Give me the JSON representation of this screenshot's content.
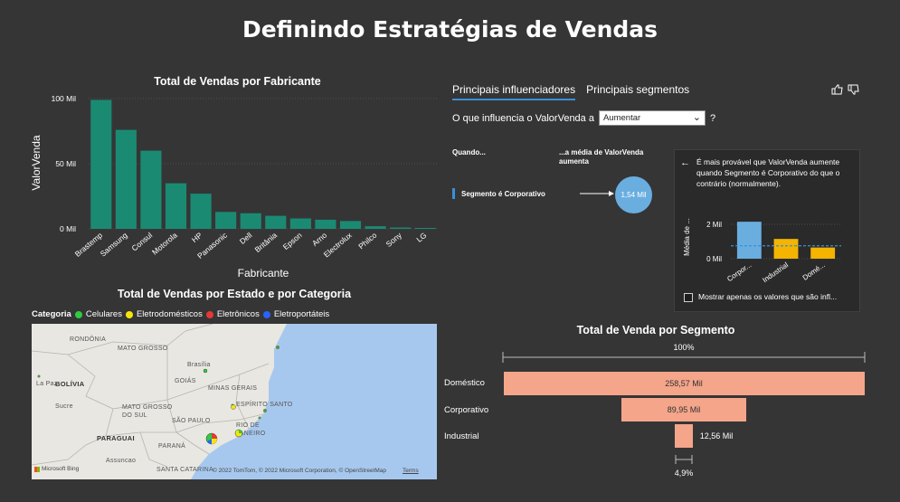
{
  "page": {
    "title": "Definindo Estratégias de Vendas"
  },
  "bar_chart": {
    "title": "Total de Vendas por Fabricante",
    "xlabel": "Fabricante",
    "ylabel": "ValorVenda",
    "y_ticks": [
      "100 Mil",
      "50 Mil",
      "0 Mil"
    ]
  },
  "chart_data": {
    "type": "bar",
    "title": "Total de Vendas por Fabricante",
    "xlabel": "Fabricante",
    "ylabel": "ValorVenda",
    "categories": [
      "Brastemp",
      "Samsung",
      "Consul",
      "Motorola",
      "HP",
      "Panasonic",
      "Dell",
      "Britânia",
      "Epson",
      "Arno",
      "Electrolux",
      "Philco",
      "Sony",
      "LG"
    ],
    "values": [
      99,
      76,
      60,
      35,
      27,
      13,
      12,
      10,
      8,
      7,
      6,
      2,
      1,
      0.7
    ],
    "unit": "Mil",
    "ylim": [
      0,
      100
    ],
    "color": "#1a8a73"
  },
  "influencers": {
    "tabs": [
      "Principais influenciadores",
      "Principais segmentos"
    ],
    "question_prefix": "O que influencia o ValorVenda a",
    "select_value": "Aumentar",
    "question_mark": "?",
    "col_when": "Quando...",
    "col_avg": "...a média de ValorVenda aumenta",
    "row_label": "Segmento é Corporativo",
    "row_value": "1,54 Mil",
    "detail_text": "É mais provável que ValorVenda aumente quando Segmento é Corporativo do que o contrário (normalmente).",
    "mini_ylabel": "Média de ...",
    "mini_ticks": [
      "2 Mil",
      "0 Mil"
    ],
    "mini_categories": [
      "Corpor...",
      "Industrial",
      "Domé..."
    ],
    "mini_values": [
      2.15,
      1.15,
      0.65
    ],
    "mini_avg": 0.75,
    "mini_colors": [
      "#6aaee0",
      "#f4b400",
      "#f4b400"
    ],
    "checkbox_label": "Mostrar apenas os valores que são infl..."
  },
  "map": {
    "title": "Total de Vendas por Estado e por Categoria",
    "legend_title": "Categoria",
    "legend": [
      {
        "label": "Celulares",
        "color": "#2ecc40"
      },
      {
        "label": "Eletrodomésticos",
        "color": "#f5e60a"
      },
      {
        "label": "Eletrônicos",
        "color": "#e53935"
      },
      {
        "label": "Eletroportáteis",
        "color": "#2962ff"
      }
    ],
    "labels": [
      "RONDÔNIA",
      "MATO GROSSO",
      "BOLÍVIA",
      "La Paz",
      "Sucre",
      "Brasília",
      "GOIÁS",
      "MINAS GERAIS",
      "MATO GROSSO DO SUL",
      "ESPÍRITO SANTO",
      "SÃO PAULO",
      "RIO DE JANEIRO",
      "PARAGUAI",
      "PARANÁ",
      "Assuncao",
      "SANTA CATARINA"
    ],
    "brand": "Microsoft Bing",
    "attribution": "© 2022 TomTom, © 2022 Microsoft Corporation, © OpenStreetMap",
    "terms": "Terms"
  },
  "funnel": {
    "title": "Total de Venda por Segmento",
    "top_pct": "100%",
    "bottom_pct": "4,9%",
    "segments": [
      {
        "label": "Doméstico",
        "value": "258,57 Mil",
        "amount": 258.57
      },
      {
        "label": "Corporativo",
        "value": "89,95 Mil",
        "amount": 89.95
      },
      {
        "label": "Industrial",
        "value": "12,56 Mil",
        "amount": 12.56
      }
    ]
  }
}
